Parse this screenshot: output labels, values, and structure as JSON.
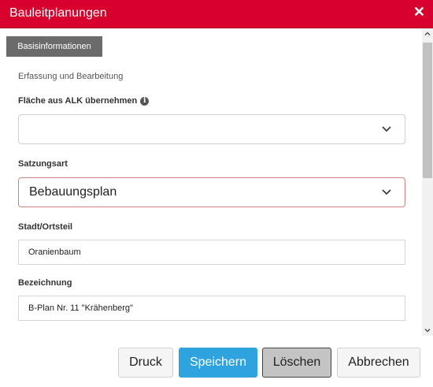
{
  "window": {
    "title": "Bauleitplanungen",
    "close_glyph": "✕",
    "accent_color": "#d8002d"
  },
  "tabs": [
    {
      "label": "Basisinformationen",
      "active": true
    }
  ],
  "section": {
    "label": "Erfassung und Bearbeitung"
  },
  "fields": {
    "flaeche": {
      "label": "Fläche aus ALK übernehmen",
      "info_icon": "i",
      "value": ""
    },
    "satzungsart": {
      "label": "Satzungsart",
      "value": "Bebauungsplan"
    },
    "stadt": {
      "label": "Stadt/Ortsteil",
      "value": "Oranienbaum"
    },
    "bezeichnung": {
      "label": "Bezeichnung",
      "value": "B-Plan Nr. 11 \"Krähenberg\""
    }
  },
  "buttons": {
    "druck": "Druck",
    "speichern": "Speichern",
    "loeschen": "Löschen",
    "abbrechen": "Abbrechen"
  }
}
